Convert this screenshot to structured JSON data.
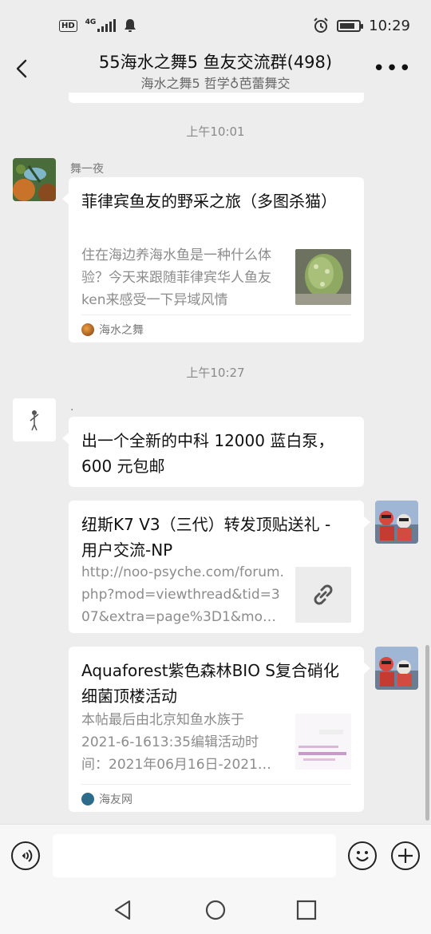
{
  "status_bar": {
    "hd": "HD",
    "network": "4G",
    "time": "10:29"
  },
  "header": {
    "title": "55海水之舞5 鱼友交流群(498)",
    "subtitle": "海水之舞5 哲学♁芭蕾舞交",
    "back_icon": "chevron-left-icon",
    "more_icon": "more-horizontal-icon"
  },
  "messages": [
    {
      "timestamp": "上午10:01",
      "sender": "舞一夜",
      "type": "link_card",
      "title": "菲律宾鱼友的野采之旅（多图杀猫）",
      "description": "住在海边养海水鱼是一种什么体验？今天来跟随菲律宾华人鱼友ken来感受一下异域风情",
      "source": "海水之舞"
    },
    {
      "timestamp": "上午10:27",
      "sender": ".",
      "type": "text",
      "text": "出一个全新的中科 12000 蓝白泵，600 元包邮"
    },
    {
      "type": "link_card",
      "from_self": true,
      "title": "纽斯K7 V3（三代）转发顶贴送礼 - 用户交流-NP",
      "description": "http://noo-psyche.com/forum.php?mod=viewthread&tid=307&extra=page%3D1&mo…",
      "thumb_icon": "link-icon"
    },
    {
      "type": "link_card",
      "from_self": true,
      "title": "Aquaforest紫色森林BIO S复合硝化细菌顶楼活动",
      "description": "本帖最后由北京知鱼水族于 2021-6-1613:35编辑活动时间：2021年06月16日-2021…",
      "source": "海友网"
    }
  ],
  "input_bar": {
    "placeholder": ""
  },
  "colors": {
    "background": "#ededed",
    "bubble": "#ffffff",
    "muted_text": "#8c8c8c"
  }
}
